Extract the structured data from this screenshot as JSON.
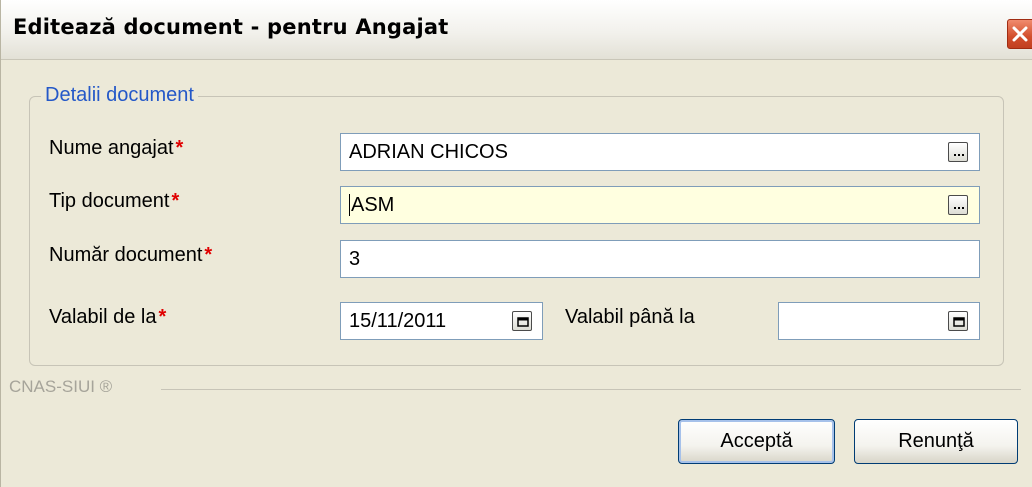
{
  "window": {
    "title": "Editează document - pentru Angajat"
  },
  "group": {
    "legend": "Detalii document"
  },
  "fields": {
    "employee": {
      "label": "Nume angajat",
      "value": "ADRIAN CHICOS",
      "required": "*"
    },
    "doc_type": {
      "label": "Tip document",
      "value": "ASM",
      "required": "*"
    },
    "doc_number": {
      "label": "Număr document",
      "value": "3",
      "required": "*"
    },
    "valid_from": {
      "label": "Valabil de la",
      "value": "15/11/2011",
      "required": "*"
    },
    "valid_to": {
      "label": "Valabil până la",
      "value": ""
    }
  },
  "footer": {
    "label": "CNAS-SIUI ®"
  },
  "buttons": {
    "accept": "Acceptă",
    "cancel": "Renunţă"
  },
  "icons": {
    "close": "close-icon",
    "browse": "ellipsis-icon",
    "calendar": "calendar-icon"
  },
  "colors": {
    "legend": "#2458c8",
    "required": "#e00000",
    "focused_field": "#ffffe0",
    "close": "#d24e2c"
  }
}
